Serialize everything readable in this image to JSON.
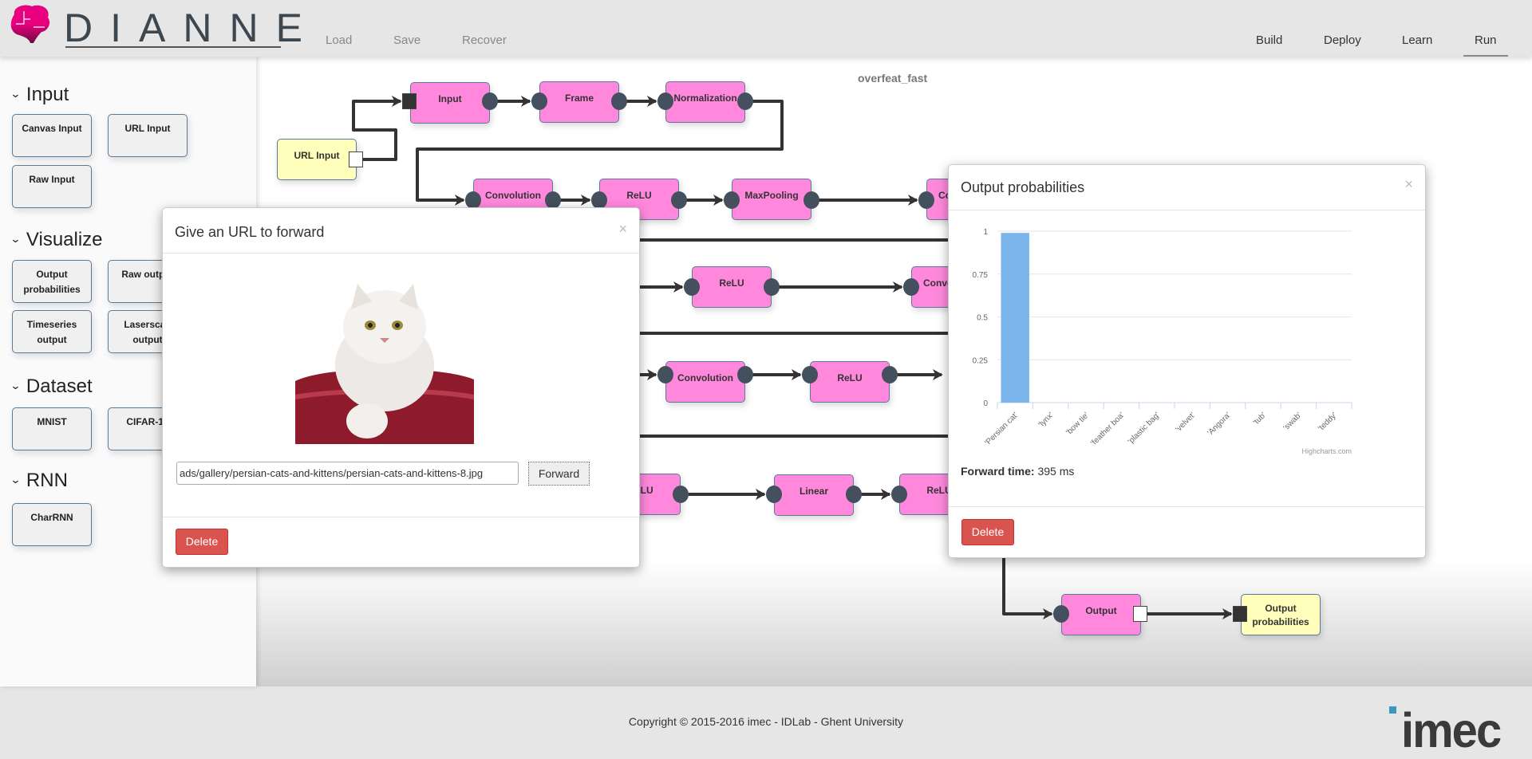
{
  "header": {
    "logo_text": "DIANNE",
    "left_nav": [
      "Load",
      "Save",
      "Recover"
    ],
    "right_nav": [
      "Build",
      "Deploy",
      "Learn",
      "Run"
    ],
    "active": "Run"
  },
  "sidebar": {
    "sections": [
      {
        "title": "Input",
        "items": [
          "Canvas Input",
          "URL Input",
          "Raw Input"
        ]
      },
      {
        "title": "Visualize",
        "items": [
          "Output probabilities",
          "Raw output",
          "Timeseries output",
          "Laserscan output"
        ]
      },
      {
        "title": "Dataset",
        "items": [
          "MNIST",
          "CIFAR-10"
        ]
      },
      {
        "title": "RNN",
        "items": [
          "CharRNN"
        ]
      }
    ]
  },
  "canvas": {
    "network_name": "overfeat_fast",
    "nodes": [
      "URL Input",
      "Input",
      "Frame",
      "Normalization",
      "Convolution",
      "ReLU",
      "MaxPooling",
      "Convolution",
      "ReLU",
      "Convolution",
      "Convolution",
      "ReLU",
      "ReLU",
      "Linear",
      "ReLU",
      "Output",
      "Output probabilities"
    ]
  },
  "url_modal": {
    "title": "Give an URL to forward",
    "close": "×",
    "url_value": "ads/gallery/persian-cats-and-kittens/persian-cats-and-kittens-8.jpg",
    "forward_label": "Forward",
    "delete_label": "Delete"
  },
  "prob_modal": {
    "title": "Output probabilities",
    "close": "×",
    "forward_time_label": "Forward time:",
    "forward_time_value": "395 ms",
    "credit": "Highcharts.com",
    "delete_label": "Delete"
  },
  "chart_data": {
    "type": "bar",
    "categories": [
      "'Persian cat'",
      "'lynx'",
      "'bow tie'",
      "'feather boa'",
      "'plastic bag'",
      "'velvet'",
      "'Angora'",
      "'tub'",
      "'swab'",
      "'teddy'"
    ],
    "values": [
      0.99,
      0,
      0,
      0,
      0,
      0,
      0,
      0,
      0,
      0
    ],
    "ylim": [
      0,
      1
    ],
    "yticks": [
      "0",
      "0.25",
      "0.5",
      "0.75",
      "1"
    ],
    "grid": true,
    "bar_color": "#7cb5ec"
  },
  "footer": {
    "copyright": "Copyright © 2015-2016 imec - IDLab - Ghent University",
    "logo_text": "imec"
  },
  "colors": {
    "node": "#ff88dd",
    "io_node": "#ffffbb",
    "port": "#44505e",
    "danger": "#d9534f"
  }
}
